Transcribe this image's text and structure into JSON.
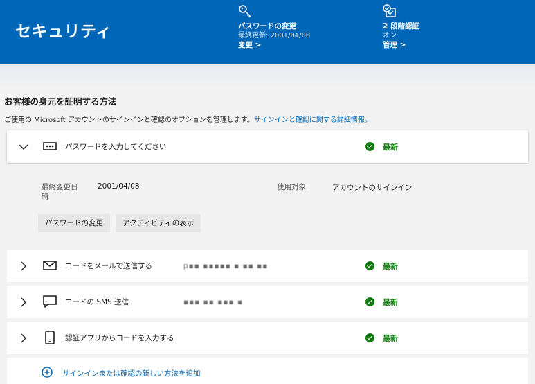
{
  "header": {
    "title": "セキュリティ",
    "password": {
      "title": "パスワードの変更",
      "subtitle": "最終更新: 2001/04/08",
      "link": "変更 >"
    },
    "twostep": {
      "title": "2 段階認証",
      "subtitle": "オン",
      "link": "管理 >"
    }
  },
  "section": {
    "title": "お客様の身元を証明する方法",
    "description": "ご使用の Microsoft アカウントのサインインと確認のオプションを管理します。",
    "description_link": "サインインと確認に関する詳細情報。"
  },
  "methods": [
    {
      "label": "パスワードを入力してください",
      "value": "",
      "status": "最新",
      "icon": "password-dots-icon",
      "expanded": true
    },
    {
      "label": "コードをメールで送信する",
      "value": "p▪▪ ▪▪▪▪▪ ▪ ▪▪ ▪▪",
      "status": "最新",
      "icon": "mail-icon",
      "expanded": false
    },
    {
      "label": "コードの SMS 送信",
      "value": "▪▪▪ ▪▪ ▪▪▪ ▪",
      "status": "最新",
      "icon": "chat-icon",
      "expanded": false
    },
    {
      "label": "認証アプリからコードを入力する",
      "value": "",
      "status": "最新",
      "icon": "phone-icon",
      "expanded": false
    }
  ],
  "password_details": {
    "last_changed_label": "最終変更日時",
    "last_changed_value": "2001/04/08",
    "used_for_label": "使用対象",
    "used_for_value": "アカウントのサインイン",
    "change_button": "パスワードの変更",
    "activity_button": "アクティビティの表示"
  },
  "add_method": {
    "label": "サインインまたは確認の新しい方法を追加"
  },
  "colors": {
    "brand": "#0067b8",
    "success": "#107c10"
  }
}
